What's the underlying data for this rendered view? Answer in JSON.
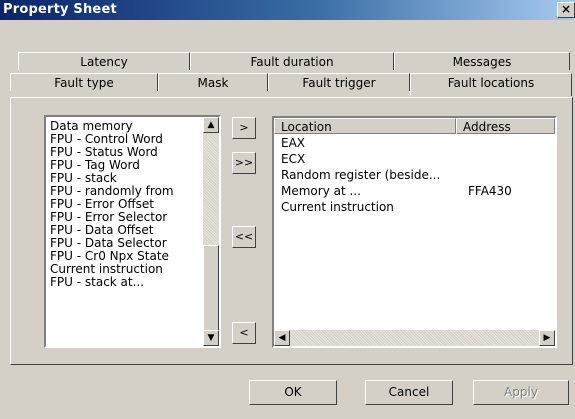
{
  "window": {
    "title": "Property Sheet",
    "close_glyph": "×"
  },
  "tabs_row1": [
    "Latency",
    "Fault duration",
    "Messages"
  ],
  "tabs_row2": [
    "Fault type",
    "Mask",
    "Fault trigger",
    "Fault locations"
  ],
  "active_tab": "Fault locations",
  "left_list": [
    "Data memory",
    "FPU - Control Word",
    "FPU - Status Word",
    "FPU - Tag Word",
    "FPU - stack",
    "FPU - randomly from",
    "FPU - Error Offset",
    "FPU - Error Selector",
    "FPU - Data Offset",
    "FPU - Data Selector",
    "FPU - Cr0 Npx State",
    "Current instruction",
    "FPU - stack at..."
  ],
  "move_buttons": {
    "add_one": ">",
    "add_all": ">>",
    "remove_all": "<<",
    "remove_one": "<"
  },
  "table": {
    "columns": [
      "Location",
      "Address"
    ],
    "rows": [
      [
        "EAX",
        ""
      ],
      [
        "ECX",
        ""
      ],
      [
        "Random register (beside...",
        ""
      ],
      [
        "Memory at ...",
        "FFA430"
      ],
      [
        "Current instruction",
        ""
      ]
    ]
  },
  "buttons": {
    "ok": "OK",
    "cancel": "Cancel",
    "apply": "Apply"
  },
  "icons": {
    "scroll_up": "▲",
    "scroll_down": "▼",
    "scroll_left": "◀",
    "scroll_right": "▶"
  }
}
